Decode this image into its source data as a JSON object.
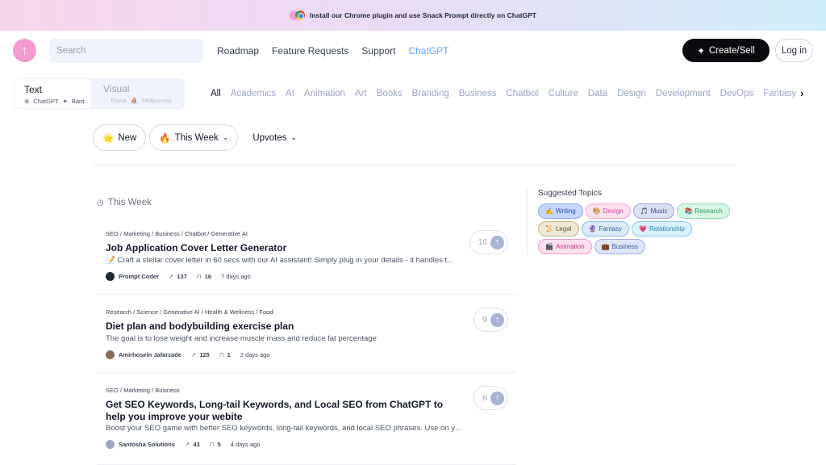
{
  "banner": {
    "text": "Install our Chrome plugin and use Snack Prompt directly on ChatGPT"
  },
  "header": {
    "search_placeholder": "Search",
    "nav": [
      {
        "label": "Roadmap",
        "active": false
      },
      {
        "label": "Feature Requests",
        "active": false
      },
      {
        "label": "Support",
        "active": false
      },
      {
        "label": "ChatGPT",
        "active": true
      }
    ],
    "create_icon": "✦",
    "create_label": "Create/Sell",
    "login_label": "Log in"
  },
  "modes": {
    "text": {
      "title": "Text",
      "subs": [
        "ChatGPT",
        "Bard"
      ]
    },
    "visual": {
      "title": "Visual",
      "subs": [
        "Eluna",
        "Midjourney"
      ]
    }
  },
  "categories": [
    "All",
    "Academics",
    "AI",
    "Animation",
    "Art",
    "Books",
    "Branding",
    "Business",
    "Chatbot",
    "Culture",
    "Data",
    "Design",
    "Development",
    "DevOps",
    "Fantasy"
  ],
  "filters": {
    "new_icon": "🌟",
    "new_label": "New",
    "week_icon": "🔥",
    "week_label": "This Week",
    "upvotes_label": "Upvotes"
  },
  "feed": {
    "section_title": "This Week",
    "cards": [
      {
        "categories": "SEO / Marketing / Business / Chatbot / Generative AI",
        "title": "Job Application Cover Letter Generator",
        "description": "📝 Craft a stellar cover letter in 60 secs with our AI assistant! Simply plug in your details - it handles t...",
        "author": "Prompt Coder",
        "uses": "137",
        "saves": "16",
        "time": "7 days ago",
        "votes": "10",
        "avatar_color": "#1f2937"
      },
      {
        "categories": "Research / Science / Generative AI / Health & Wellness / Food",
        "title": "Diet plan and bodybuilding exercise plan",
        "description": "The goal is to lose weight and increase muscle mass and reduce fat percentage",
        "author": "Amirhosein Jafarzade",
        "uses": "125",
        "saves": "1",
        "time": "2 days ago",
        "votes": "9",
        "avatar_color": "#8b6b5a"
      },
      {
        "categories": "SEO / Marketing / Business",
        "title": "Get SEO Keywords, Long-tail Keywords, and Local SEO from ChatGPT to help you improve your webite",
        "description": "Boost your SEO game with better SEO keywords, long-tail keywords, and local SEO phrases. Use on you...",
        "author": "Santosha Solutions",
        "uses": "43",
        "saves": "5",
        "time": "4 days ago",
        "votes": "6",
        "avatar_color": "#9aa6c4"
      }
    ]
  },
  "topics": {
    "title": "Suggested Topics",
    "items": [
      {
        "icon": "✍️",
        "label": "Writing",
        "bg": "#c7d6fb",
        "border": "#8ea8ee",
        "color": "#2c4fb3"
      },
      {
        "icon": "🎨",
        "label": "Design",
        "bg": "#fbe0f0",
        "border": "#f3a6d3",
        "color": "#d04aa0"
      },
      {
        "icon": "🎵",
        "label": "Music",
        "bg": "#dbe0f5",
        "border": "#9ba6d8",
        "color": "#3e4a8a"
      },
      {
        "icon": "📚",
        "label": "Research",
        "bg": "#d8f6e6",
        "border": "#8fd9b3",
        "color": "#2f9c68"
      },
      {
        "icon": "📜",
        "label": "Legal",
        "bg": "#ede7d6",
        "border": "#c5b88e",
        "color": "#6b5d32"
      },
      {
        "icon": "🔮",
        "label": "Fantasy",
        "bg": "#dcebfa",
        "border": "#8eb5e8",
        "color": "#3566b0"
      },
      {
        "icon": "💗",
        "label": "Relationship",
        "bg": "#d9f1fb",
        "border": "#85cbe9",
        "color": "#2a82ad"
      },
      {
        "icon": "🎬",
        "label": "Animation",
        "bg": "#fbe0ef",
        "border": "#ef9cc8",
        "color": "#c23e88"
      },
      {
        "icon": "💼",
        "label": "Business",
        "bg": "#dde5f8",
        "border": "#9fb2e2",
        "color": "#3d58a0"
      }
    ]
  }
}
